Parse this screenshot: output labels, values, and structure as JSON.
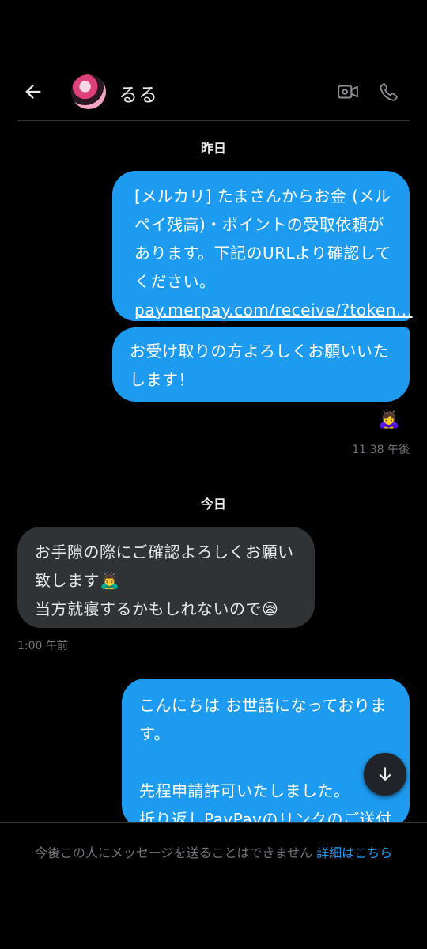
{
  "header": {
    "contact_name": "るる"
  },
  "dates": {
    "yesterday": "昨日",
    "today": "今日"
  },
  "messages": [
    {
      "lines": [
        "[メルカリ] たまさんからお金 (メル",
        "ペイ残高)・ポイントの受取依頼が",
        "あります。下記のURLより確認して",
        "ください。"
      ],
      "link": "pay.merpay.com/receive/?token..."
    },
    {
      "lines": [
        "お受け取りの方よろしくお願いいた",
        "します！"
      ]
    },
    {
      "lines": [
        "お手隙の際にご確認よろしくお願い",
        "致します🙇‍♂️",
        "当方就寝するかもしれないので😪"
      ]
    },
    {
      "lines": [
        "こんにちは お世話になっておりま",
        "す。",
        "",
        "先程申請許可いたしました。",
        "折り返しPayPayのリンクのご送付"
      ]
    }
  ],
  "reaction": "🙇‍♀️",
  "timestamps": {
    "out": "11:38 午後",
    "in": "1:00 午前"
  },
  "footer": {
    "notice": "今後この人にメッセージを送ることはできません ",
    "link": "詳細はこちら"
  },
  "colors": {
    "accent": "#1d9bf0",
    "incoming_bubble": "#2f3336",
    "background": "#000000"
  }
}
